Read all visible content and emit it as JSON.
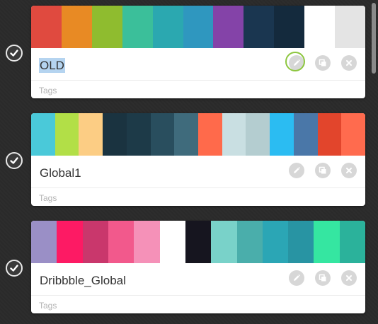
{
  "palettes": [
    {
      "name": "OLD",
      "tags_placeholder": "Tags",
      "selected": true,
      "edit_active": true,
      "colors": [
        "#e04a3f",
        "#e88a24",
        "#8fbc2f",
        "#3bbf9a",
        "#2ba8b0",
        "#2f97bf",
        "#8443a8",
        "#1a3650",
        "#142a3d",
        "#ffffff",
        "#e4e4e4"
      ]
    },
    {
      "name": "Global1",
      "tags_placeholder": "Tags",
      "selected": false,
      "edit_active": false,
      "colors": [
        "#4ac9d9",
        "#b2df47",
        "#fccd84",
        "#1a3340",
        "#1d3a48",
        "#294e5e",
        "#3f6b7c",
        "#ff6a4b",
        "#c9dfe2",
        "#b4cdd0",
        "#2bbcf2",
        "#4a77a8",
        "#e2452c",
        "#ff6b4e"
      ]
    },
    {
      "name": "Dribbble_Global",
      "tags_placeholder": "Tags",
      "selected": false,
      "edit_active": false,
      "colors": [
        "#9a8fc6",
        "#fd1a64",
        "#c9376c",
        "#f2598c",
        "#f591b8",
        "#ffffff",
        "#16151f",
        "#79d2c9",
        "#4aaeab",
        "#2ba6b5",
        "#2894a3",
        "#35e6a1",
        "#2bb29b"
      ]
    }
  ],
  "icons": {
    "check": "check-circle-icon",
    "edit": "pencil-icon",
    "duplicate": "duplicate-icon",
    "delete": "close-icon"
  }
}
